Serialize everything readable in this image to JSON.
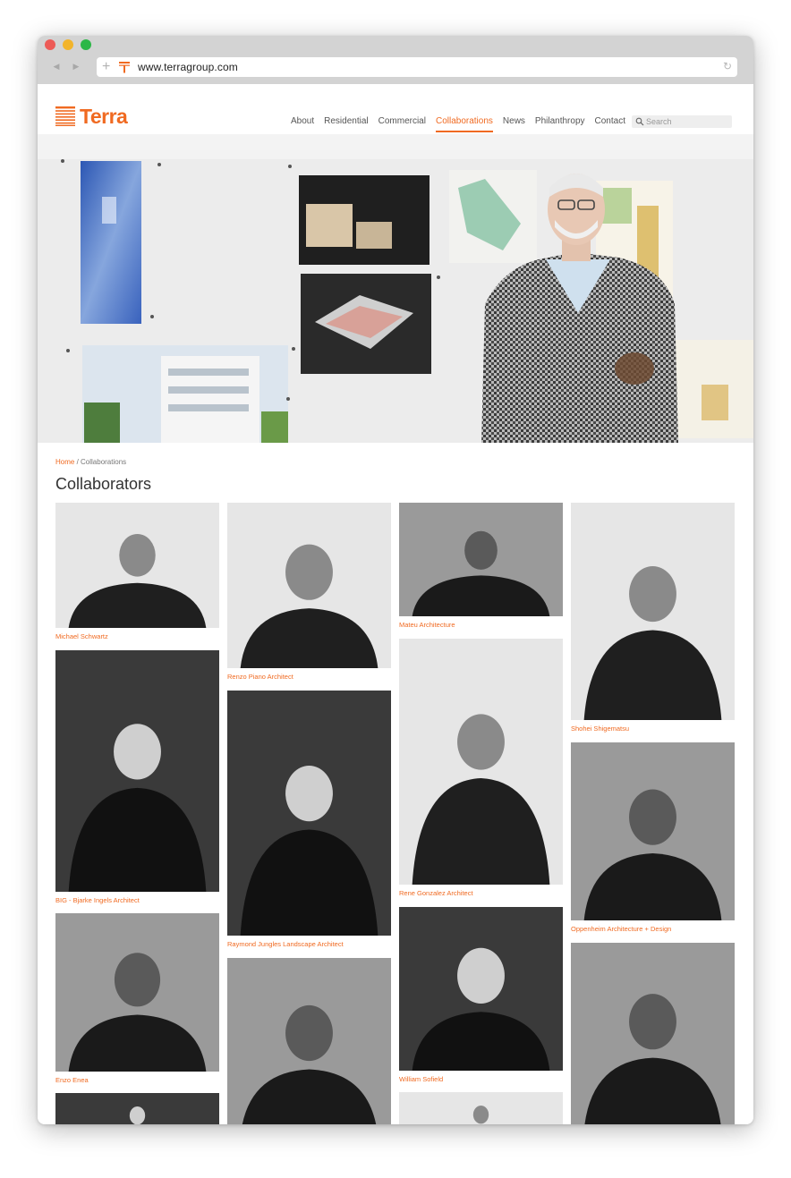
{
  "browser": {
    "url": "www.terragroup.com"
  },
  "site": {
    "brand": "Terra",
    "brand_color": "#f06a21",
    "nav": [
      {
        "label": "About",
        "active": false
      },
      {
        "label": "Residential",
        "active": false
      },
      {
        "label": "Commercial",
        "active": false
      },
      {
        "label": "Collaborations",
        "active": true
      },
      {
        "label": "News",
        "active": false
      },
      {
        "label": "Philanthropy",
        "active": false
      },
      {
        "label": "Contact",
        "active": false
      }
    ],
    "search_placeholder": "Search",
    "breadcrumb": {
      "home": "Home",
      "separator": " / ",
      "current": "Collaborations"
    },
    "page_title": "Collaborators"
  },
  "collaborators": [
    {
      "name": "Michael Schwartz",
      "tone": "light"
    },
    {
      "name": "BIG - Bjarke Ingels Architect",
      "tone": "dark"
    },
    {
      "name": "Enzo Enea",
      "tone": "mid"
    },
    {
      "name": "Renzo Piano Architect",
      "tone": "light"
    },
    {
      "name": "Raymond Jungles Landscape Architect",
      "tone": "dark"
    },
    {
      "name": "Mateu Architecture",
      "tone": "mid"
    },
    {
      "name": "Rene Gonzalez Architect",
      "tone": "light"
    },
    {
      "name": "William Sofield",
      "tone": "dark"
    },
    {
      "name": "Shohei Shigematsu",
      "tone": "light"
    },
    {
      "name": "Oppenheim Architecture + Design",
      "tone": "mid"
    },
    {
      "name": "",
      "tone": "mid"
    },
    {
      "name": "",
      "tone": "dark"
    },
    {
      "name": "",
      "tone": "light"
    }
  ]
}
